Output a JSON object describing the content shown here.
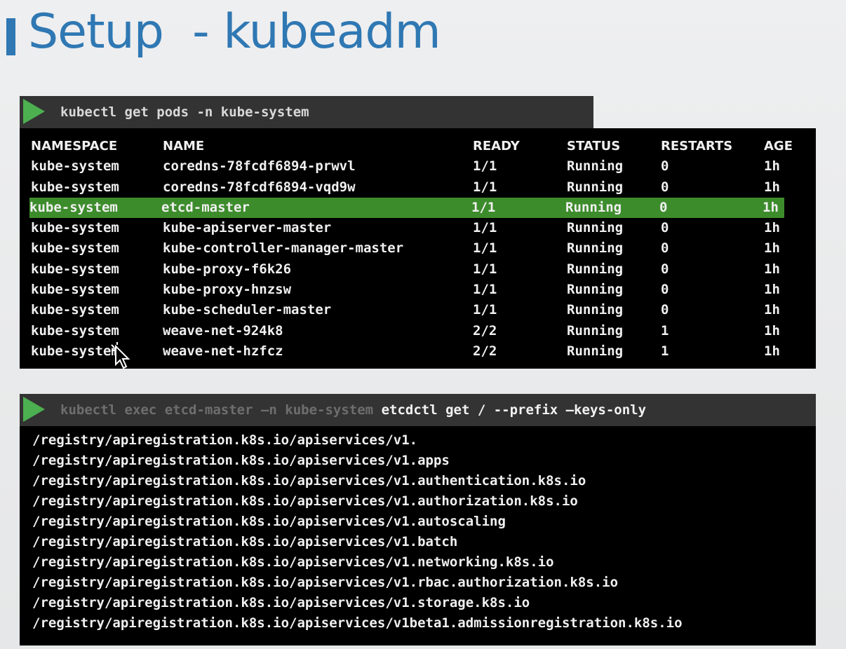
{
  "title": "Setup  - kubeadm",
  "command1": "kubectl get pods -n kube-system",
  "command2": {
    "dim_part": "kubectl exec etcd-master –n kube-system ",
    "bright_part": "etcdctl get / --prefix –keys-only"
  },
  "pods": {
    "headers": {
      "namespace": "NAMESPACE",
      "name": "NAME",
      "ready": "READY",
      "status": "STATUS",
      "restarts": "RESTARTS",
      "age": "AGE"
    },
    "rows": [
      {
        "namespace": "kube-system",
        "name": "coredns-78fcdf6894-prwvl",
        "ready": "1/1",
        "status": "Running",
        "restarts": "0",
        "age": "1h"
      },
      {
        "namespace": "kube-system",
        "name": "coredns-78fcdf6894-vqd9w",
        "ready": "1/1",
        "status": "Running",
        "restarts": "0",
        "age": "1h"
      },
      {
        "namespace": "kube-system",
        "name": "etcd-master",
        "ready": "1/1",
        "status": "Running",
        "restarts": "0",
        "age": "1h"
      },
      {
        "namespace": "kube-system",
        "name": "kube-apiserver-master",
        "ready": "1/1",
        "status": "Running",
        "restarts": "0",
        "age": "1h"
      },
      {
        "namespace": "kube-system",
        "name": "kube-controller-manager-master",
        "ready": "1/1",
        "status": "Running",
        "restarts": "0",
        "age": "1h"
      },
      {
        "namespace": "kube-system",
        "name": "kube-proxy-f6k26",
        "ready": "1/1",
        "status": "Running",
        "restarts": "0",
        "age": "1h"
      },
      {
        "namespace": "kube-system",
        "name": "kube-proxy-hnzsw",
        "ready": "1/1",
        "status": "Running",
        "restarts": "0",
        "age": "1h"
      },
      {
        "namespace": "kube-system",
        "name": "kube-scheduler-master",
        "ready": "1/1",
        "status": "Running",
        "restarts": "0",
        "age": "1h"
      },
      {
        "namespace": "kube-system",
        "name": "weave-net-924k8",
        "ready": "2/2",
        "status": "Running",
        "restarts": "1",
        "age": "1h"
      },
      {
        "namespace": "kube-system",
        "name": "weave-net-hzfcz",
        "ready": "2/2",
        "status": "Running",
        "restarts": "1",
        "age": "1h"
      }
    ]
  },
  "keys": [
    "/registry/apiregistration.k8s.io/apiservices/v1.",
    "/registry/apiregistration.k8s.io/apiservices/v1.apps",
    "/registry/apiregistration.k8s.io/apiservices/v1.authentication.k8s.io",
    "/registry/apiregistration.k8s.io/apiservices/v1.authorization.k8s.io",
    "/registry/apiregistration.k8s.io/apiservices/v1.autoscaling",
    "/registry/apiregistration.k8s.io/apiservices/v1.batch",
    "/registry/apiregistration.k8s.io/apiservices/v1.networking.k8s.io",
    "/registry/apiregistration.k8s.io/apiservices/v1.rbac.authorization.k8s.io",
    "/registry/apiregistration.k8s.io/apiservices/v1.storage.k8s.io",
    "/registry/apiregistration.k8s.io/apiservices/v1beta1.admissionregistration.k8s.io"
  ],
  "colors": {
    "title": "#2f78b3",
    "play_icon": "#4caf50",
    "highlight_row": "#3d8c2c",
    "terminal_bg": "#000000",
    "command_bar_bg": "#333333"
  },
  "icons": {
    "play": "play-icon",
    "cursor": "mouse-pointer-icon"
  }
}
